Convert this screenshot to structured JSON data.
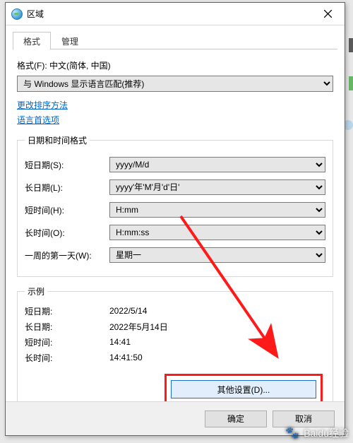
{
  "window": {
    "title": "区域"
  },
  "tabs": {
    "format": "格式",
    "admin": "管理"
  },
  "format_section": {
    "label": "格式(F): 中文(简体, 中国)",
    "dropdown_value": "与 Windows 显示语言匹配(推荐)"
  },
  "links": {
    "sort": "更改排序方法",
    "lang_prefs": "语言首选项"
  },
  "datetime_group": {
    "legend": "日期和时间格式",
    "short_date": {
      "label": "短日期(S):",
      "value": "yyyy/M/d"
    },
    "long_date": {
      "label": "长日期(L):",
      "value": "yyyy'年'M'月'd'日'"
    },
    "short_time": {
      "label": "短时间(H):",
      "value": "H:mm"
    },
    "long_time": {
      "label": "长时间(O):",
      "value": "H:mm:ss"
    },
    "first_day": {
      "label": "一周的第一天(W):",
      "value": "星期一"
    }
  },
  "examples_group": {
    "legend": "示例",
    "short_date": {
      "label": "短日期:",
      "value": "2022/5/14"
    },
    "long_date": {
      "label": "长日期:",
      "value": "2022年5月14日"
    },
    "short_time": {
      "label": "短时间:",
      "value": "14:41"
    },
    "long_time": {
      "label": "长时间:",
      "value": "14:41:50"
    }
  },
  "buttons": {
    "additional": "其他设置(D)...",
    "ok": "确定",
    "cancel": "取消"
  },
  "watermark": "Baidu经验"
}
